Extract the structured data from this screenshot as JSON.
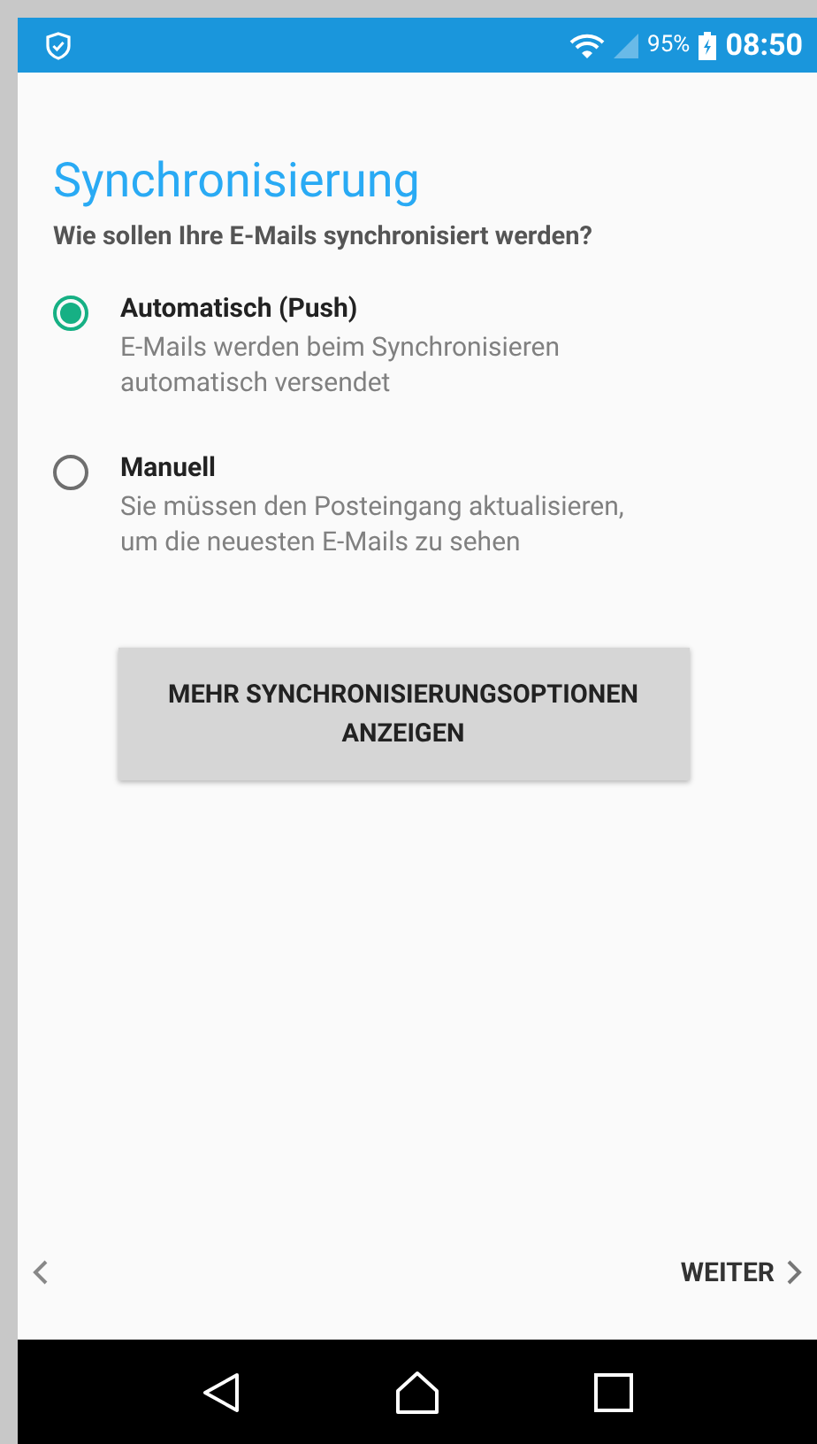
{
  "status_bar": {
    "battery_percent": "95%",
    "time": "08:50"
  },
  "title": "Synchronisierung",
  "subtitle": "Wie sollen Ihre E-Mails synchronisiert werden?",
  "options": [
    {
      "label": "Automatisch (Push)",
      "description": "E-Mails werden beim Synchronisieren automatisch versendet",
      "selected": true
    },
    {
      "label": "Manuell",
      "description": "Sie müssen den Posteingang aktualisieren, um die neuesten E-Mails zu sehen",
      "selected": false
    }
  ],
  "more_button": "MEHR SYNCHRONISIERUNGSOPTIONEN ANZEIGEN",
  "footer": {
    "next": "WEITER"
  }
}
